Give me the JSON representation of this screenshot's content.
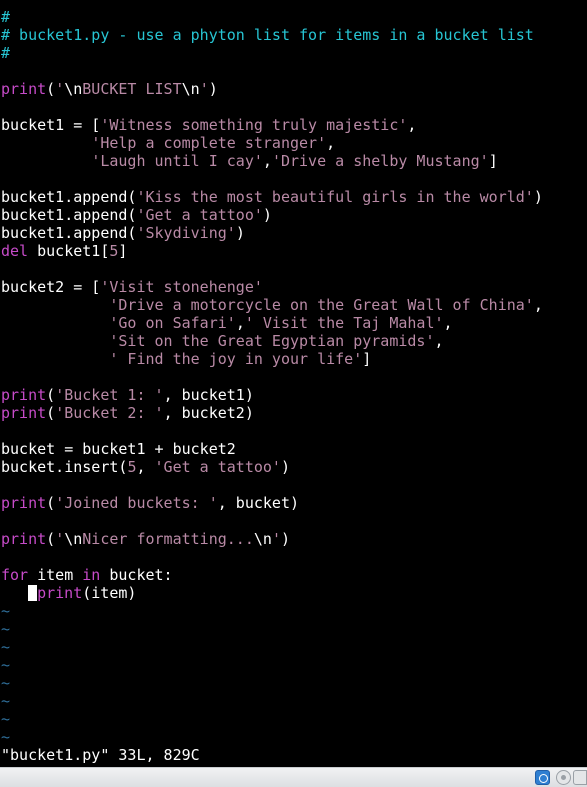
{
  "editor": {
    "file_name": "bucket1.py",
    "colors": {
      "comment": "#27c5d3",
      "keyword": "#c64bc8",
      "string": "#b98aa6",
      "default": "#ffffff",
      "tilde": "#2f6f9a"
    },
    "lines": [
      [
        [
          "comment",
          "#"
        ]
      ],
      [
        [
          "comment",
          "# bucket1.py - use a phyton list for items in a bucket list"
        ]
      ],
      [
        [
          "comment",
          "#"
        ]
      ],
      [],
      [
        [
          "keyword",
          "print"
        ],
        [
          "default",
          "("
        ],
        [
          "string",
          "'"
        ],
        [
          "default",
          "\\n"
        ],
        [
          "string",
          "BUCKET LIST"
        ],
        [
          "default",
          "\\n"
        ],
        [
          "string",
          "'"
        ],
        [
          "default",
          ")"
        ]
      ],
      [],
      [
        [
          "default",
          "bucket1 = ["
        ],
        [
          "string",
          "'Witness something truly majestic'"
        ],
        [
          "default",
          ","
        ]
      ],
      [
        [
          "default",
          "          "
        ],
        [
          "string",
          "'Help a complete stranger'"
        ],
        [
          "default",
          ","
        ]
      ],
      [
        [
          "default",
          "          "
        ],
        [
          "string",
          "'Laugh until I cay'"
        ],
        [
          "default",
          ","
        ],
        [
          "string",
          "'Drive a shelby Mustang'"
        ],
        [
          "default",
          "]"
        ]
      ],
      [],
      [
        [
          "default",
          "bucket1.append("
        ],
        [
          "string",
          "'Kiss the most beautiful girls in the world'"
        ],
        [
          "default",
          ")"
        ]
      ],
      [
        [
          "default",
          "bucket1.append("
        ],
        [
          "string",
          "'Get a tattoo'"
        ],
        [
          "default",
          ")"
        ]
      ],
      [
        [
          "default",
          "bucket1.append("
        ],
        [
          "string",
          "'Skydiving'"
        ],
        [
          "default",
          ")"
        ]
      ],
      [
        [
          "keyword",
          "del"
        ],
        [
          "default",
          " bucket1["
        ],
        [
          "string",
          "5"
        ],
        [
          "default",
          "]"
        ]
      ],
      [],
      [
        [
          "default",
          "bucket2 = ["
        ],
        [
          "string",
          "'Visit stonehenge'"
        ]
      ],
      [
        [
          "default",
          "            "
        ],
        [
          "string",
          "'Drive a motorcycle on the Great Wall of China'"
        ],
        [
          "default",
          ","
        ]
      ],
      [
        [
          "default",
          "            "
        ],
        [
          "string",
          "'Go on Safari'"
        ],
        [
          "default",
          ","
        ],
        [
          "string",
          "' Visit the Taj Mahal'"
        ],
        [
          "default",
          ","
        ]
      ],
      [
        [
          "default",
          "            "
        ],
        [
          "string",
          "'Sit on the Great Egyptian pyramids'"
        ],
        [
          "default",
          ","
        ]
      ],
      [
        [
          "default",
          "            "
        ],
        [
          "string",
          "' Find the joy in your life'"
        ],
        [
          "default",
          "]"
        ]
      ],
      [],
      [
        [
          "keyword",
          "print"
        ],
        [
          "default",
          "("
        ],
        [
          "string",
          "'Bucket 1: '"
        ],
        [
          "default",
          ", bucket1)"
        ]
      ],
      [
        [
          "keyword",
          "print"
        ],
        [
          "default",
          "("
        ],
        [
          "string",
          "'Bucket 2: '"
        ],
        [
          "default",
          ", bucket2)"
        ]
      ],
      [],
      [
        [
          "default",
          "bucket = bucket1 + bucket2"
        ]
      ],
      [
        [
          "default",
          "bucket.insert("
        ],
        [
          "string",
          "5"
        ],
        [
          "default",
          ", "
        ],
        [
          "string",
          "'Get a tattoo'"
        ],
        [
          "default",
          ")"
        ]
      ],
      [],
      [
        [
          "keyword",
          "print"
        ],
        [
          "default",
          "("
        ],
        [
          "string",
          "'Joined buckets: '"
        ],
        [
          "default",
          ", bucket)"
        ]
      ],
      [],
      [
        [
          "keyword",
          "print"
        ],
        [
          "default",
          "("
        ],
        [
          "string",
          "'"
        ],
        [
          "default",
          "\\n"
        ],
        [
          "string",
          "Nicer formatting..."
        ],
        [
          "default",
          "\\n"
        ],
        [
          "string",
          "'"
        ],
        [
          "default",
          ")"
        ]
      ],
      [],
      [
        [
          "keyword",
          "for"
        ],
        [
          "default",
          " item "
        ],
        [
          "keyword",
          "in"
        ],
        [
          "default",
          " bucket:"
        ]
      ],
      [
        [
          "default",
          "   "
        ],
        [
          "cursor",
          ""
        ],
        [
          "keyword",
          "print"
        ],
        [
          "default",
          "(item)"
        ]
      ]
    ],
    "empty_line_marker": "~",
    "empty_line_count": 8,
    "status_message": "\"bucket1.py\" 33L, 829C"
  },
  "taskbar": {
    "tray_icons": [
      "virtualbox-icon",
      "optical-disc-icon",
      "network-icon"
    ]
  }
}
